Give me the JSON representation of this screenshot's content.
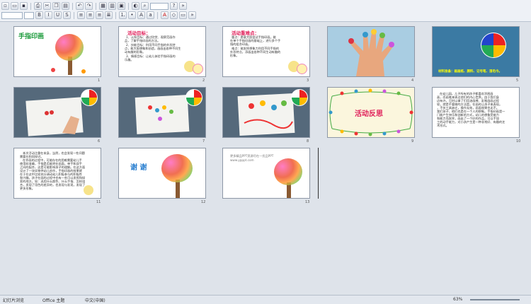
{
  "slides": [
    {
      "num": "1",
      "title": "手指印画"
    },
    {
      "num": "2",
      "heading": "活动目标：",
      "lines": [
        "1、认知目标：通过欣赏、观察范画作",
        "品，了解手指印画的方法。",
        "2、技能目标：利用不同手指的外形特",
        "点，能大胆想象和创造，画画出各种不同生",
        "动有趣的形象。",
        "3、情感目标：让幼儿体验手指印画的",
        "乐趣。"
      ]
    },
    {
      "num": "3",
      "heading": "活动重难点：",
      "lines": [
        "重点：愿意大胆尝试手指印画，能",
        "在单个手指印画的基础上，进行多个手",
        "指的组合印画。",
        "难点：能发挥想象力利用不同手指的",
        "外形特点，添画出各种不同生动有趣的",
        "形象。"
      ]
    },
    {
      "num": "4"
    },
    {
      "num": "5",
      "caption": "材料准备：画画纸、颜料、记号笔、湿毛巾。"
    },
    {
      "num": "6"
    },
    {
      "num": "7"
    },
    {
      "num": "8"
    },
    {
      "num": "9",
      "title": "活动反思"
    },
    {
      "num": "10",
      "lines": [
        "在幼儿园，儿子所有的孩子都喜欢涂鸦画",
        "画，而画笔来表达他们的内心世界。由于我们身",
        "边有许，可时以拿了们用油画棒、彩笔画画过程",
        "较，就是不要做的方法是。在画时让孩子来表现。",
        "，不仅工具缺乏，操作无效，画面效果也无不。",
        "我们孩子，他们也是在一个人的想象。手指印画是一",
        "门能产生快乐和创新的方式，幼儿的想象受能力",
        "和能力而发挥，画出了一个好的作品，可以手加",
        "工的动手能力，对小孩产生是一种非常好、有趣的艺",
        "术形式。"
      ]
    },
    {
      "num": "11",
      "lines": [
        "本次活动注重在本身，当然，也会发现一些问题",
        "需要在和同探讨。",
        "在作画的过程中，可能存在的困难需要幼儿手",
        "使用较准确，手指是否能把在画面，单手和双手",
        "之间的配合，这是可能影响孩子的理解。在这方面",
        "设计了一块实物供幼儿创作，手指印画的效果就",
        "在于在这中比较充分调动幼儿积极参与的积极性",
        "和兴趣。孩子在画的过程中也有一些可以发挥和探",
        "索的地方，如：选用什么颜色、什么手指、怎样组",
        "合，发现了用色的差异的，也发现与发现，发现了",
        "更多形象。"
      ]
    },
    {
      "num": "12",
      "title": "谢 谢"
    },
    {
      "num": "13",
      "lines": [
        "更多精品PPT资源尽在—优品PPT",
        "www.ypppt.com"
      ]
    }
  ],
  "status": {
    "slide": "幻灯片浏览",
    "theme": "Office 主题",
    "lang": "中文(中国)",
    "zoom": "63%"
  }
}
